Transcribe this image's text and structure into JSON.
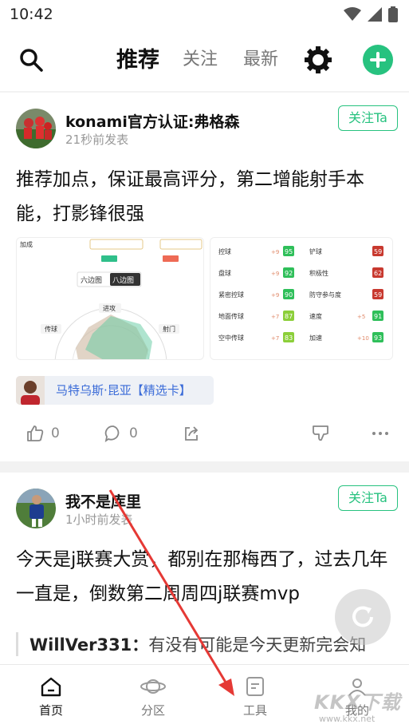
{
  "status": {
    "time": "10:42"
  },
  "nav": {
    "tabs": [
      {
        "label": "推荐",
        "active": true
      },
      {
        "label": "关注",
        "active": false
      },
      {
        "label": "最新",
        "active": false
      }
    ]
  },
  "posts": [
    {
      "author": "konami官方认证:弗格森",
      "time": "21秒前发表",
      "follow_label": "关注Ta",
      "text": "推荐加点，保证最高评分，第二增能射手本能，打影锋很强",
      "image_left": {
        "header_label": "加成",
        "toggle": [
          "六边图",
          "八边图"
        ],
        "radar_labels": [
          "进攻",
          "传球",
          "射门"
        ]
      },
      "image_right": {
        "rows": [
          {
            "l": "控球",
            "lb": "+9",
            "lv": "95",
            "r": "铲球",
            "rb": "",
            "rv": "59"
          },
          {
            "l": "盘球",
            "lb": "+9",
            "lv": "92",
            "r": "积极性",
            "rb": "",
            "rv": "62"
          },
          {
            "l": "紧密控球",
            "lb": "+9",
            "lv": "90",
            "r": "防守参与度",
            "rb": "",
            "rv": "59"
          },
          {
            "l": "地面传球",
            "lb": "+7",
            "lv": "87",
            "r": "速度",
            "rb": "+5",
            "rv": "91"
          },
          {
            "l": "空中传球",
            "lb": "+7",
            "lv": "83",
            "r": "加速",
            "rb": "+10",
            "rv": "93"
          }
        ]
      },
      "player_tag": "马特乌斯·昆亚【精选卡】",
      "likes": "0",
      "comments": "0"
    },
    {
      "author": "我不是库里",
      "time": "1小时前发表",
      "follow_label": "关注Ta",
      "text": "今天是j联赛大赏，都别在那梅西了，过去几年一直是，倒数第二周周四j联赛mvp",
      "quote_user": "WillVer331：",
      "quote_text": "有没有可能是今天更新完会知"
    }
  ],
  "bottom_nav": [
    {
      "label": "首页",
      "active": true
    },
    {
      "label": "分区",
      "active": false
    },
    {
      "label": "工具",
      "active": false
    },
    {
      "label": "我的",
      "active": false
    }
  ],
  "watermark": {
    "brand": "KKX下载",
    "url": "www.kkx.net"
  },
  "colors": {
    "accent": "#27c27f",
    "tag_blue": "#3a6bd8",
    "arrow": "#e53935"
  }
}
